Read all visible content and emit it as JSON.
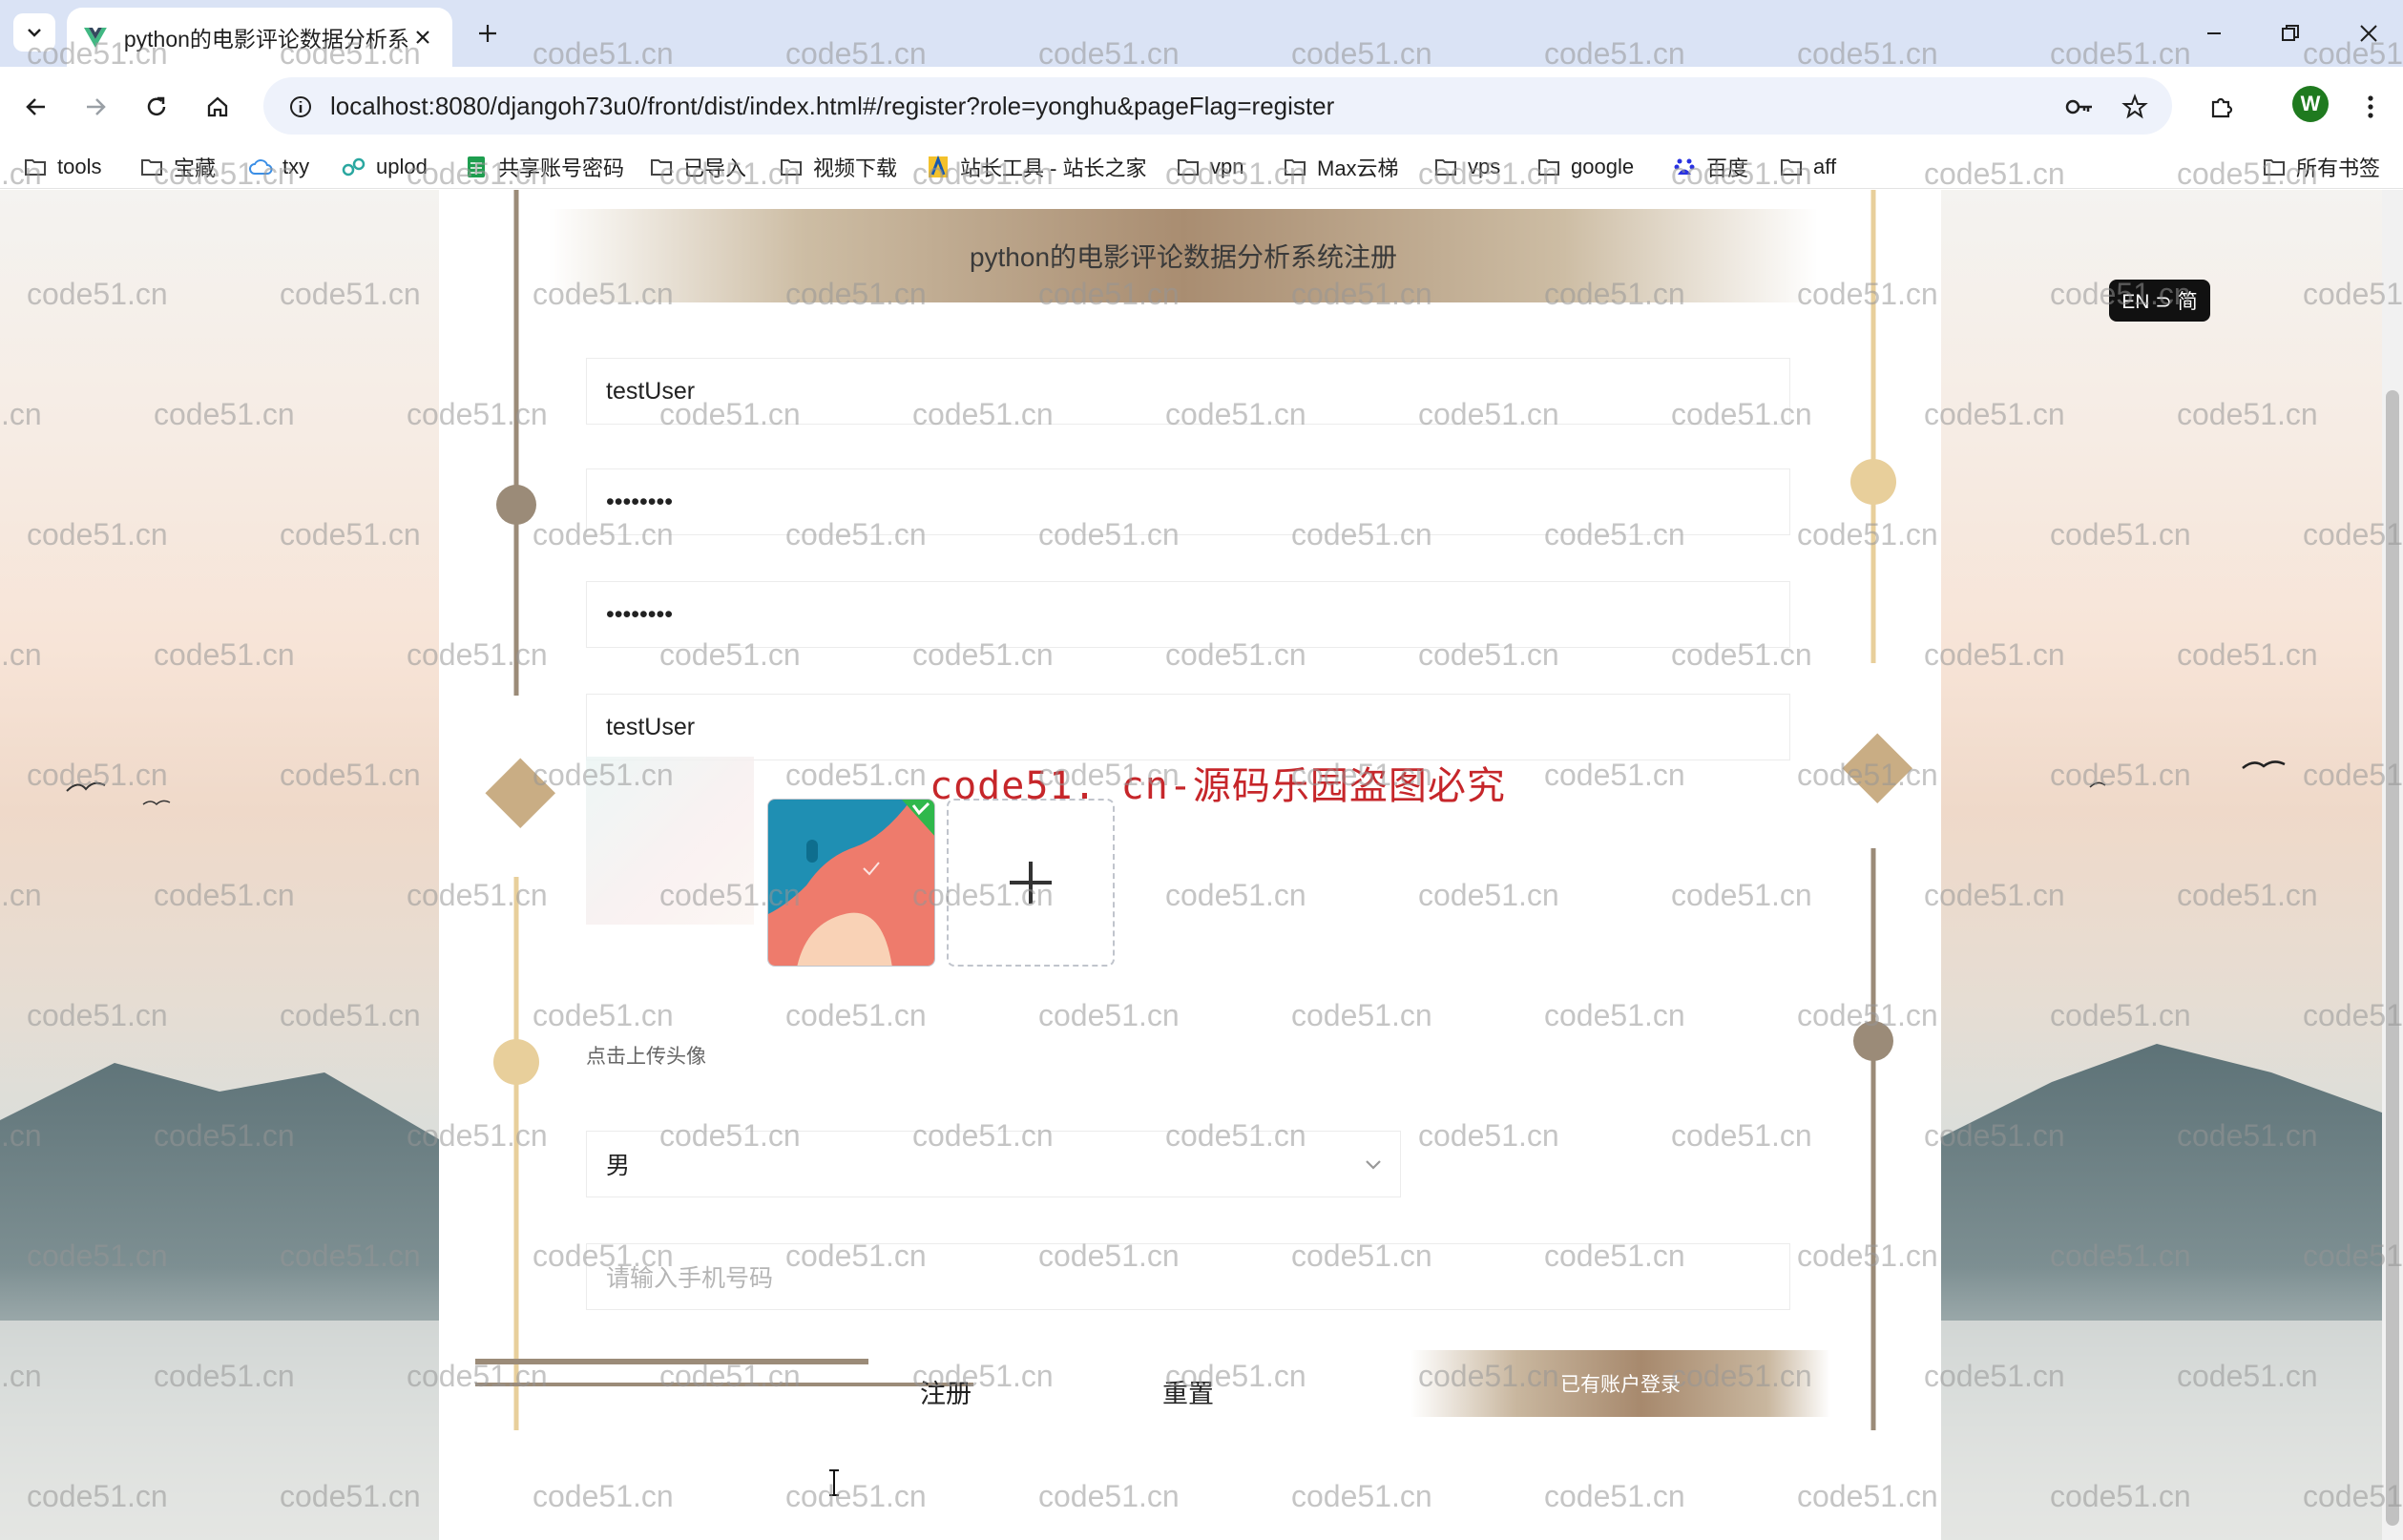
{
  "browser": {
    "tab_title": "python的电影评论数据分析系",
    "url": "localhost:8080/djangoh73u0/front/dist/index.html#/register?role=yonghu&pageFlag=register",
    "profile_initial": "W",
    "bookmarks": [
      {
        "label": "tools",
        "icon": "folder-icon"
      },
      {
        "label": "宝藏",
        "icon": "folder-icon"
      },
      {
        "label": "txy",
        "icon": "cloud-icon"
      },
      {
        "label": "uplod",
        "icon": "share-icon"
      },
      {
        "label": "共享账号密码",
        "icon": "sheet-icon"
      },
      {
        "label": "已导入",
        "icon": "folder-icon"
      },
      {
        "label": "视频下载",
        "icon": "folder-icon"
      },
      {
        "label": "站长工具 - 站长之家",
        "icon": "site-icon"
      },
      {
        "label": "vpn",
        "icon": "folder-icon"
      },
      {
        "label": "Max云梯",
        "icon": "folder-icon"
      },
      {
        "label": "vps",
        "icon": "folder-icon"
      },
      {
        "label": "google",
        "icon": "folder-icon"
      },
      {
        "label": "百度",
        "icon": "baidu-icon"
      },
      {
        "label": "aff",
        "icon": "folder-icon"
      }
    ],
    "all_bookmarks": "所有书签"
  },
  "page": {
    "form_title": "python的电影评论数据分析系统注册",
    "lang_toggle": "EN ⊃ 简",
    "fields": {
      "account": "testUser",
      "password": "••••••••",
      "confirm_password": "••••••••",
      "name": "testUser",
      "gender": "男",
      "phone_placeholder": "请输入手机号码"
    },
    "upload_tip": "点击上传头像",
    "buttons": {
      "register": "注册",
      "reset": "重置",
      "login": "已有账户登录"
    },
    "watermark_main": "code51. cn-源码乐园盗图必究",
    "watermark_tile": "code51.cn",
    "colors": {
      "accent_brown": "#a98d71",
      "accent_gold": "#e0c58c",
      "watermark_red": "#c6262a"
    }
  }
}
